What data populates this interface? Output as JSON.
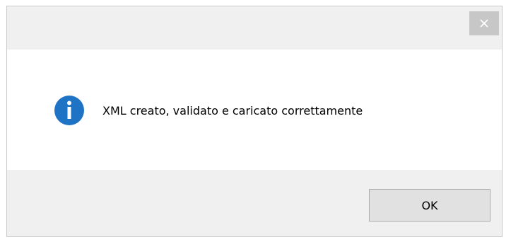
{
  "dialog": {
    "close_icon": "close-icon",
    "info_icon": "info-icon",
    "message": "XML creato, validato e caricato correttamente",
    "ok_label": "OK"
  },
  "colors": {
    "info_icon_blue": "#1f73c4",
    "close_button_bg": "#c7c7c7",
    "dialog_bg": "#f0f0f0",
    "content_bg": "#ffffff"
  }
}
